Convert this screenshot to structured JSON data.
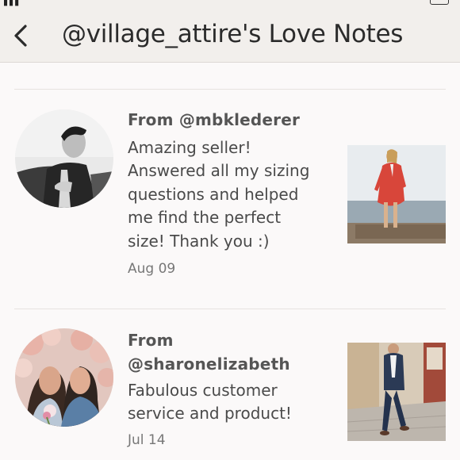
{
  "header": {
    "title": "@village_attire's Love Notes"
  },
  "notes": [
    {
      "from_prefix": "From",
      "username": "@mbklederer",
      "message_lines": [
        "Amazing seller!",
        "Answered all my sizing",
        "questions and helped",
        "me find the perfect",
        "size! Thank you :)"
      ],
      "date": "Aug 09"
    },
    {
      "from_prefix": "From",
      "username": "@sharonelizabeth",
      "message_lines": [
        "Fabulous customer",
        "service and product!"
      ],
      "date": "Jul 14"
    }
  ],
  "icons": {
    "back": "chevron-left-icon"
  },
  "colors": {
    "header_bg": "#f2efec",
    "page_bg": "#fbf9f9",
    "text": "#4a4a4a",
    "muted": "#777777"
  }
}
